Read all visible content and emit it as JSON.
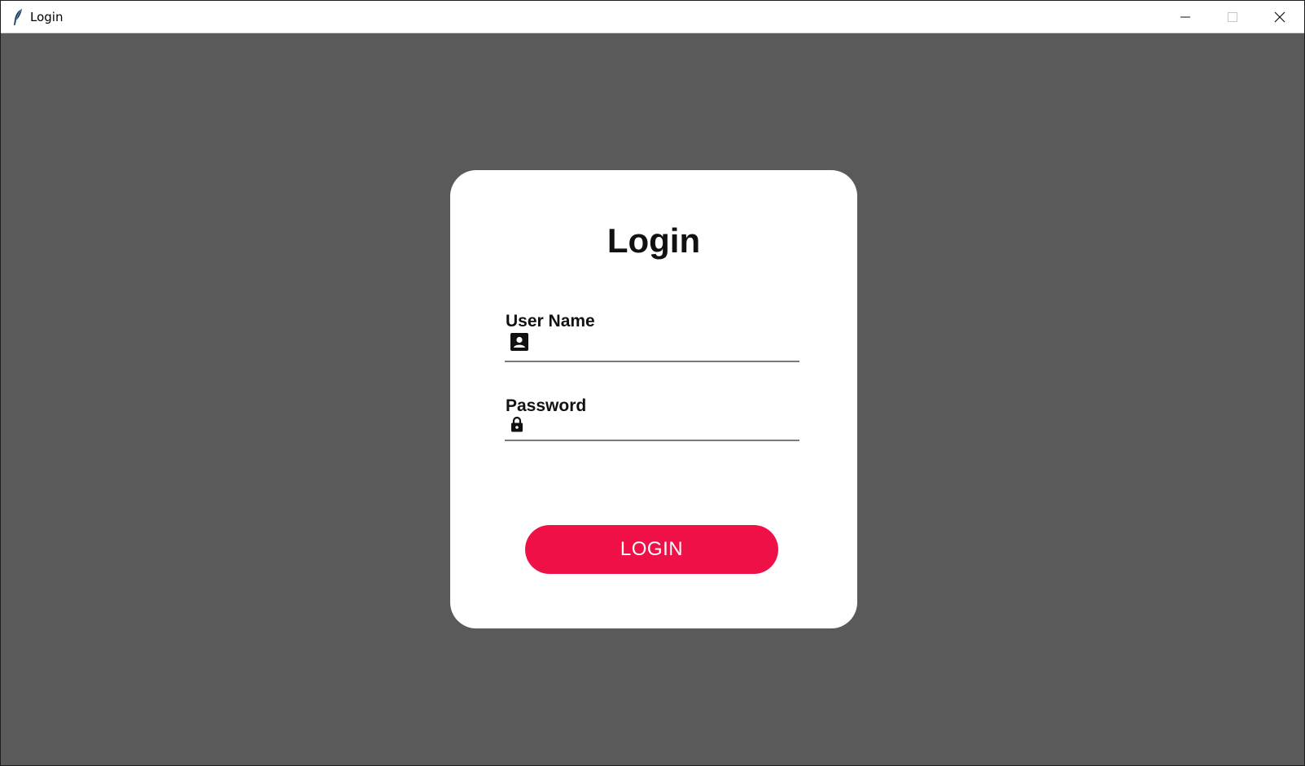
{
  "window": {
    "title": "Login",
    "app_icon": "feather-icon",
    "controls": [
      "minimize-icon",
      "maximize-icon",
      "close-icon"
    ]
  },
  "form": {
    "heading": "Login",
    "username": {
      "label": "User Name",
      "icon": "user-card-icon",
      "value": ""
    },
    "password": {
      "label": "Password",
      "icon": "lock-icon",
      "value": ""
    },
    "submit_label": "LOGIN"
  },
  "colors": {
    "background": "#5a5a5a",
    "card": "#ffffff",
    "accent": "#f01048",
    "text": "#111111"
  }
}
